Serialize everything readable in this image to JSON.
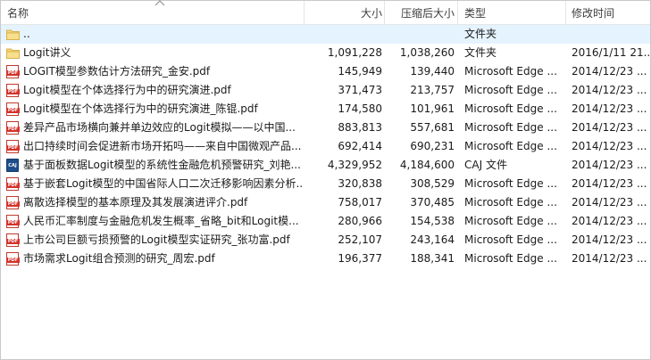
{
  "columns": {
    "name": "名称",
    "size": "大小",
    "compressed": "压缩后大小",
    "type": "类型",
    "modified": "修改时间"
  },
  "rows": [
    {
      "name": "..",
      "size": "",
      "compressed": "",
      "type": "文件夹",
      "modified": "",
      "icon": "folder-icon"
    },
    {
      "name": "Logit讲义",
      "size": "1,091,228",
      "compressed": "1,038,260",
      "type": "文件夹",
      "modified": "2016/1/11 21...",
      "icon": "folder-icon"
    },
    {
      "name": "LOGIT模型参数估计方法研究_金安.pdf",
      "size": "145,949",
      "compressed": "139,440",
      "type": "Microsoft Edge ...",
      "modified": "2014/12/23 ...",
      "icon": "pdf-icon"
    },
    {
      "name": "Logit模型在个体选择行为中的研究演进.pdf",
      "size": "371,473",
      "compressed": "213,757",
      "type": "Microsoft Edge ...",
      "modified": "2014/12/23 ...",
      "icon": "pdf-icon"
    },
    {
      "name": "Logit模型在个体选择行为中的研究演进_陈锟.pdf",
      "size": "174,580",
      "compressed": "101,961",
      "type": "Microsoft Edge ...",
      "modified": "2014/12/23 ...",
      "icon": "pdf-icon"
    },
    {
      "name": "差异产品市场横向兼并单边效应的Logit模拟——以中国...",
      "size": "883,813",
      "compressed": "557,681",
      "type": "Microsoft Edge ...",
      "modified": "2014/12/23 ...",
      "icon": "pdf-icon"
    },
    {
      "name": "出口持续时间会促进新市场开拓吗——来自中国微观产品...",
      "size": "692,414",
      "compressed": "690,231",
      "type": "Microsoft Edge ...",
      "modified": "2014/12/23 ...",
      "icon": "pdf-icon"
    },
    {
      "name": "基于面板数据Logit模型的系统性金融危机预警研究_刘艳...",
      "size": "4,329,952",
      "compressed": "4,184,600",
      "type": "CAJ 文件",
      "modified": "2014/12/23 ...",
      "icon": "caj-icon"
    },
    {
      "name": "基于嵌套Logit模型的中国省际人口二次迁移影响因素分析...",
      "size": "320,838",
      "compressed": "308,529",
      "type": "Microsoft Edge ...",
      "modified": "2014/12/23 ...",
      "icon": "pdf-icon"
    },
    {
      "name": "离散选择模型的基本原理及其发展演进评介.pdf",
      "size": "758,017",
      "compressed": "370,485",
      "type": "Microsoft Edge ...",
      "modified": "2014/12/23 ...",
      "icon": "pdf-icon"
    },
    {
      "name": "人民币汇率制度与金融危机发生概率_省略_bit和Logit模...",
      "size": "280,966",
      "compressed": "154,538",
      "type": "Microsoft Edge ...",
      "modified": "2014/12/23 ...",
      "icon": "pdf-icon"
    },
    {
      "name": "上市公司巨额亏损预警的Logit模型实证研究_张功富.pdf",
      "size": "252,107",
      "compressed": "243,164",
      "type": "Microsoft Edge ...",
      "modified": "2014/12/23 ...",
      "icon": "pdf-icon"
    },
    {
      "name": "市场需求Logit组合预测的研究_周宏.pdf",
      "size": "196,377",
      "compressed": "188,341",
      "type": "Microsoft Edge ...",
      "modified": "2014/12/23 ...",
      "icon": "pdf-icon"
    }
  ],
  "icons": {
    "pdf_label": "PDF",
    "caj_label": "CAJ"
  },
  "colors": {
    "selected_row": "#e5f3ff",
    "folder": "#f5d77a",
    "pdf": "#d4322b",
    "caj": "#1f4e8c"
  }
}
